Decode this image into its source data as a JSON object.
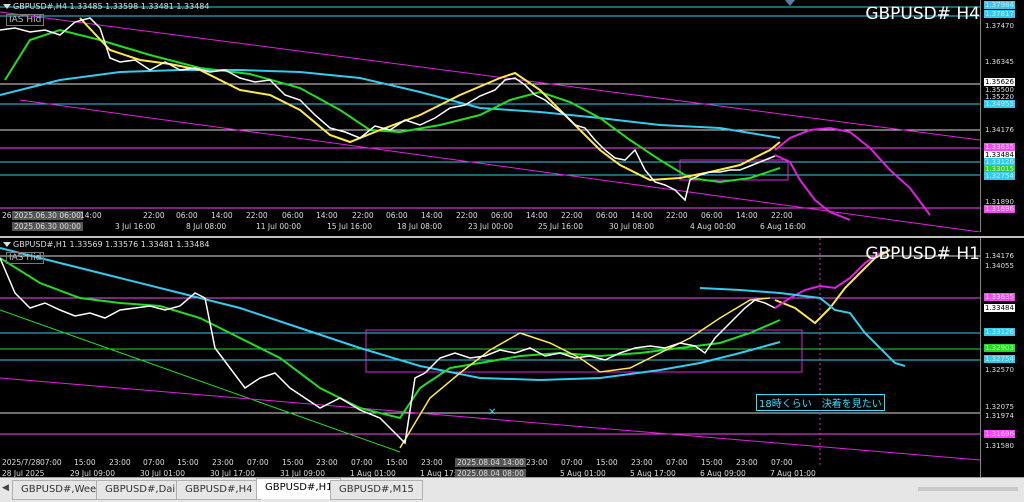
{
  "colors": {
    "background": "#000000",
    "price_line": "#ffffff",
    "yellow_ma": "#ffe84a",
    "green_ma": "#22dd22",
    "cyan_ma": "#33ccee",
    "channel": "#e020e0",
    "level_cyan": "#33ccee",
    "level_white": "#dddddd",
    "level_magenta": "#ff44ff"
  },
  "top_pane": {
    "ohlc": "GBPUSD#,H4 1.33485 1.33598 1.33481 1.33484",
    "indicator_label": "IAS Hid",
    "title": "GBPUSD# H4",
    "price_labels": [
      "1.37984",
      "1.37817",
      "1.37470",
      "1.36345",
      "1.35626",
      "1.35500",
      "1.35220",
      "1.34955",
      "1.34176",
      "1.33635",
      "1.33484",
      "1.33126",
      "1.33015",
      "1.32754",
      "1.31890",
      "1.31696"
    ],
    "time_labels": [
      "26",
      "2025.06.30 06:00",
      "14:00",
      "22:00",
      "06:00",
      "14:00",
      "22:00",
      "06:00",
      "14:00",
      "22:00",
      "06:00",
      "14:00",
      "22:00",
      "06:00",
      "14:00",
      "22:00",
      "06:00",
      "14:00",
      "22:00",
      "06:00",
      "14:00",
      "22:00",
      "06:00",
      "14:00",
      "22:00"
    ],
    "time_labels_2": [
      "2025.06.30 00:00",
      "3 Jul 16:00",
      "8 Jul 08:00",
      "11 Jul 00:00",
      "15 Jul 16:00",
      "18 Jul 08:00",
      "23 Jul 00:00",
      "25 Jul 16:00",
      "30 Jul 08:00",
      "4 Aug 00:00",
      "6 Aug 16:00"
    ]
  },
  "bottom_pane": {
    "ohlc": "GBPUSD#,H1 1.33569 1.33576 1.33481 1.33484",
    "indicator_label": "IAS Hid",
    "title": "GBPUSD# H1",
    "price_labels": [
      "1.34176",
      "1.34055",
      "1.33635",
      "1.33484",
      "1.33126",
      "1.32903",
      "1.32754",
      "1.32570",
      "1.32075",
      "1.31974",
      "1.31696",
      "1.31580"
    ],
    "time_labels": [
      "2025/7/28",
      "07:00",
      "15:00",
      "23:00",
      "07:00",
      "15:00",
      "23:00",
      "07:00",
      "15:00",
      "23:00",
      "07:00",
      "15:00",
      "23:00",
      "07:00",
      "15:00",
      "23:00",
      "07:00",
      "15:00",
      "23:00",
      "07:00",
      "15:00",
      "23:00",
      "07:00",
      "15:00",
      "23:00",
      "07:00"
    ],
    "time_labels_2": [
      "28 Jul 2025",
      "29 Jul 09:00",
      "30 Jul 01:00",
      "30 Jul 17:00",
      "31 Jul 09:00",
      "1 Aug 01:00",
      "1 Aug 17:00",
      "2025.08.04 14:00",
      "2025.08.04 08:00",
      "5 Aug 01:00",
      "5 Aug 17:00",
      "6 Aug 09:00",
      "7 Aug 01:00"
    ],
    "annotation": "18時くらい　決着を見たい"
  },
  "tabs": [
    {
      "label": "GBPUSD#,Weekly",
      "active": false
    },
    {
      "label": "GBPUSD#,Daily",
      "active": false
    },
    {
      "label": "GBPUSD#,H4",
      "active": false
    },
    {
      "label": "GBPUSD#,H1",
      "active": true
    },
    {
      "label": "GBPUSD#,M15",
      "active": false
    }
  ]
}
